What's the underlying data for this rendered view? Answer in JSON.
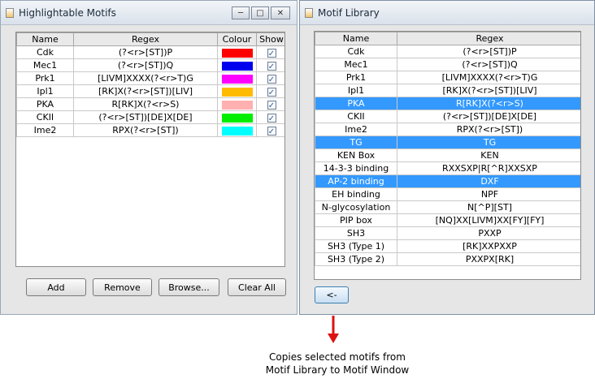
{
  "motifs_window": {
    "title": "Highlightable Motifs",
    "columns": [
      "Name",
      "Regex",
      "Colour",
      "Show"
    ],
    "rows": [
      {
        "name": "Cdk",
        "regex": "(?<r>[ST])P",
        "colour": "#ff0000",
        "show": true
      },
      {
        "name": "Mec1",
        "regex": "(?<r>[ST])Q",
        "colour": "#0000ee",
        "show": true
      },
      {
        "name": "Prk1",
        "regex": "[LIVM]XXXX(?<r>T)G",
        "colour": "#ff00ff",
        "show": true
      },
      {
        "name": "Ipl1",
        "regex": "[RK]X(?<r>[ST])[LIV]",
        "colour": "#ffbb00",
        "show": true
      },
      {
        "name": "PKA",
        "regex": "R[RK]X(?<r>S)",
        "colour": "#ffb0b0",
        "show": true
      },
      {
        "name": "CKII",
        "regex": "(?<r>[ST])[DE]X[DE]",
        "colour": "#00ee00",
        "show": true
      },
      {
        "name": "Ime2",
        "regex": "RPX(?<r>[ST])",
        "colour": "#00ffff",
        "show": true
      }
    ],
    "buttons": {
      "add": "Add",
      "remove": "Remove",
      "browse": "Browse...",
      "clear_all": "Clear All"
    }
  },
  "library_window": {
    "title": "Motif Library",
    "columns": [
      "Name",
      "Regex"
    ],
    "rows": [
      {
        "name": "Cdk",
        "regex": "(?<r>[ST])P",
        "selected": false
      },
      {
        "name": "Mec1",
        "regex": "(?<r>[ST])Q",
        "selected": false
      },
      {
        "name": "Prk1",
        "regex": "[LIVM]XXXX(?<r>T)G",
        "selected": false
      },
      {
        "name": "Ipl1",
        "regex": "[RK]X(?<r>[ST])[LIV]",
        "selected": false
      },
      {
        "name": "PKA",
        "regex": "R[RK]X(?<r>S)",
        "selected": true
      },
      {
        "name": "CKII",
        "regex": "(?<r>[ST])[DE]X[DE]",
        "selected": false
      },
      {
        "name": "Ime2",
        "regex": "RPX(?<r>[ST])",
        "selected": false
      },
      {
        "name": "TG",
        "regex": "TG",
        "selected": true
      },
      {
        "name": "KEN Box",
        "regex": "KEN",
        "selected": false
      },
      {
        "name": "14-3-3 binding",
        "regex": "RXXSXP|R[^R]XXSXP",
        "selected": false
      },
      {
        "name": "AP-2 binding",
        "regex": "DXF",
        "selected": true
      },
      {
        "name": "EH binding",
        "regex": "NPF",
        "selected": false
      },
      {
        "name": "N-glycosylation",
        "regex": "N[^P][ST]",
        "selected": false
      },
      {
        "name": "PIP box",
        "regex": "[NQ]XX[LIVM]XX[FY][FY]",
        "selected": false
      },
      {
        "name": "SH3",
        "regex": "PXXP",
        "selected": false
      },
      {
        "name": "SH3 (Type 1)",
        "regex": "[RK]XXPXXP",
        "selected": false
      },
      {
        "name": "SH3 (Type 2)",
        "regex": "PXXPX[RK]",
        "selected": false
      }
    ],
    "copy_button": "<-"
  },
  "annotation": {
    "line1": "Copies selected motifs from",
    "line2": "Motif Library to Motif Window",
    "arrow_color": "#dd1111"
  }
}
